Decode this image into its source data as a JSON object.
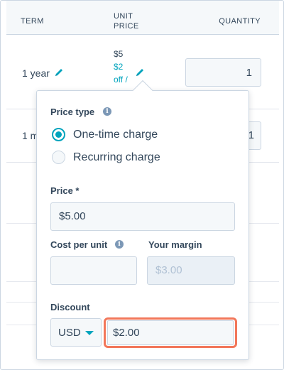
{
  "table": {
    "headers": {
      "term": "TERM",
      "unit_price": "UNIT PRICE",
      "quantity": "QUANTITY"
    },
    "rows": [
      {
        "term": "1 year",
        "price_line1": "$5",
        "price_line2": "$2",
        "price_line3": "off /",
        "quantity": "1"
      },
      {
        "term": "1 m"
      }
    ]
  },
  "popover": {
    "price_type_label": "Price type",
    "options": [
      "One-time charge",
      "Recurring charge"
    ],
    "selected_option": "One-time charge",
    "price_label": "Price *",
    "price_value": "$5.00",
    "cost_label": "Cost per unit",
    "cost_value": "",
    "margin_label": "Your margin",
    "margin_placeholder": "$3.00",
    "discount_label": "Discount",
    "currency": "USD",
    "discount_value": "$2.00"
  },
  "colors": {
    "accent": "#00a4bd",
    "highlight": "#f2775a",
    "text": "#33475b",
    "border": "#cbd6e2"
  }
}
